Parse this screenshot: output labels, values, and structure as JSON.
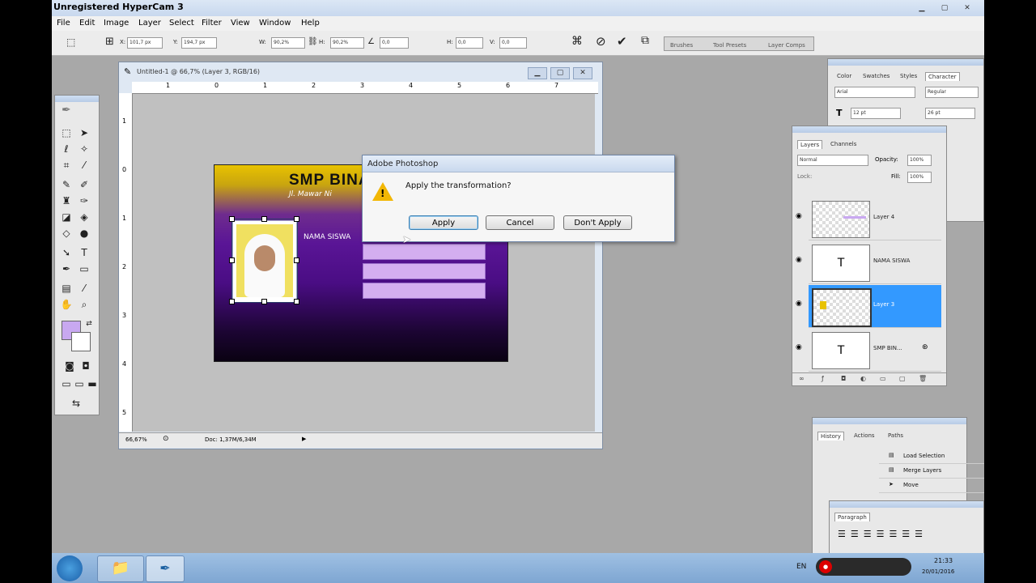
{
  "window": {
    "title": "Unregistered HyperCam 3"
  },
  "menu": [
    "File",
    "Edit",
    "Image",
    "Layer",
    "Select",
    "Filter",
    "View",
    "Window",
    "Help"
  ],
  "options": {
    "x": "101,7 px",
    "y": "194,7 px",
    "w": "90,2%",
    "h": "90,2%",
    "angle": "0,0",
    "hskew": "0,0",
    "vskew": "0,0",
    "x_label": "X:",
    "y_label": "Y:",
    "w_label": "W:",
    "h_label": "H:",
    "h2_label": "H:",
    "v_label": "V:"
  },
  "well_tabs": [
    "Brushes",
    "Tool Presets",
    "Layer Comps"
  ],
  "document": {
    "title": "Untitled-1 @ 66,7% (Layer 3, RGB/16)",
    "zoom": "66,67%",
    "doc_size": "Doc: 1,37M/6,34M",
    "ruler_h": [
      "1",
      "0",
      "1",
      "2",
      "3",
      "4",
      "5",
      "6",
      "7"
    ],
    "ruler_v": [
      "1",
      "0",
      "1",
      "2",
      "3",
      "4",
      "5"
    ]
  },
  "card": {
    "title": "SMP BINA",
    "subtitle": "Jl. Mawar Ni",
    "name_label": "NAMA SISWA"
  },
  "dialog": {
    "title": "Adobe Photoshop",
    "message": "Apply the transformation?",
    "apply": "Apply",
    "cancel": "Cancel",
    "dont_apply": "Don't Apply"
  },
  "character_panel": {
    "tabs": [
      "Color",
      "Swatches",
      "Styles",
      "Character"
    ],
    "font": "Arial",
    "style": "Regular",
    "size": "12 pt",
    "leading": "26 pt"
  },
  "layers_panel": {
    "tabs": [
      "Layers",
      "Channels"
    ],
    "blend": "Normal",
    "opacity_label": "Opacity:",
    "opacity": "100%",
    "lock_label": "Lock:",
    "fill_label": "Fill:",
    "fill": "100%",
    "layers": [
      {
        "name": "Layer 4",
        "type": "image"
      },
      {
        "name": "NAMA SISWA",
        "type": "text"
      },
      {
        "name": "Layer 3",
        "type": "image",
        "selected": true
      },
      {
        "name": "SMP BIN...",
        "type": "text"
      }
    ]
  },
  "history_panel": {
    "tabs": [
      "History",
      "Actions",
      "Paths"
    ],
    "items": [
      "Load Selection",
      "Merge Layers",
      "Move"
    ]
  },
  "paragraph_panel": {
    "tabs": [
      "Paragraph"
    ]
  },
  "taskbar": {
    "lang": "EN",
    "time": "21:33",
    "date": "20/01/2016"
  },
  "colors": {
    "foreground": "#c8a8f0",
    "selected_layer": "#3399ff"
  }
}
